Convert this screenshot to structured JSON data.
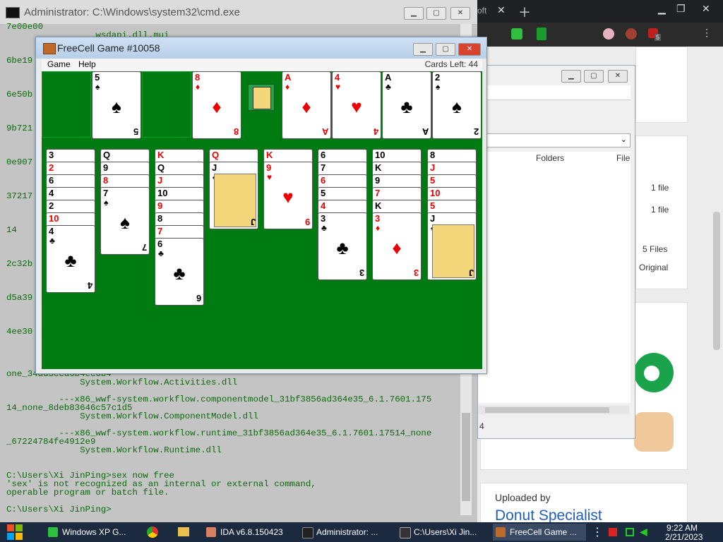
{
  "cmd": {
    "title": "Administrator: C:\\Windows\\system32\\cmd.exe",
    "lines": [
      "7e00e00",
      "                 wsdapi.dll.mui",
      "6be19",
      "6e50b",
      "9b721",
      "0e907",
      "37217",
      "14",
      "2c32b",
      "d5a39",
      "4ee30",
      "one_34dd3cca6b4ec6b4",
      "              System.Workflow.Activities.dll",
      "          ---x86_wwf-system.workflow.componentmodel_31bf3856ad364e35_6.1.7601.175",
      "14_none_8deb83646c57c1d5",
      "              System.Workflow.ComponentModel.dll",
      "          ---x86_wwf-system.workflow.runtime_31bf3856ad364e35_6.1.7601.17514_none",
      "_67224784fe4912e9",
      "              System.Workflow.Runtime.dll",
      "C:\\Users\\Xi JinPing>sex now free",
      "'sex' is not recognized as an internal or external command,",
      "operable program or batch file.",
      "C:\\Users\\Xi JinPing>"
    ]
  },
  "freecell": {
    "title": "FreeCell Game #10058",
    "menu": [
      "Game",
      "Help"
    ],
    "cards_left": "Cards Left: 44",
    "free_cells": [
      {
        "rank": "",
        "suit": ""
      },
      {
        "rank": "5",
        "suit": "♠",
        "color": "black"
      },
      {
        "rank": "",
        "suit": ""
      },
      {
        "rank": "8",
        "suit": "♦",
        "color": "red"
      }
    ],
    "home_cells": [
      {
        "rank": "A",
        "suit": "♦",
        "color": "red"
      },
      {
        "rank": "4",
        "suit": "♥",
        "color": "red"
      },
      {
        "rank": "A",
        "suit": "♣",
        "color": "black"
      },
      {
        "rank": "2",
        "suit": "♠",
        "color": "black"
      }
    ],
    "columns": [
      [
        {
          "r": "3",
          "s": "♠",
          "c": "black"
        },
        {
          "r": "2",
          "s": "♥",
          "c": "red"
        },
        {
          "r": "6",
          "s": "♠",
          "c": "black"
        },
        {
          "r": "4",
          "s": "♠",
          "c": "black"
        },
        {
          "r": "2",
          "s": "♠",
          "c": "black"
        },
        {
          "r": "10",
          "s": "♥",
          "c": "red"
        },
        {
          "r": "4",
          "s": "♣",
          "c": "black"
        }
      ],
      [
        {
          "r": "Q",
          "s": "♠",
          "c": "black"
        },
        {
          "r": "9",
          "s": "♠",
          "c": "black"
        },
        {
          "r": "8",
          "s": "♥",
          "c": "red"
        },
        {
          "r": "7",
          "s": "♠",
          "c": "black"
        }
      ],
      [
        {
          "r": "K",
          "s": "♥",
          "c": "red"
        },
        {
          "r": "Q",
          "s": "♠",
          "c": "black"
        },
        {
          "r": "J",
          "s": "♥",
          "c": "red"
        },
        {
          "r": "10",
          "s": "♠",
          "c": "black"
        },
        {
          "r": "9",
          "s": "♥",
          "c": "red"
        },
        {
          "r": "8",
          "s": "♠",
          "c": "black"
        },
        {
          "r": "7",
          "s": "♥",
          "c": "red"
        },
        {
          "r": "6",
          "s": "♣",
          "c": "black"
        }
      ],
      [
        {
          "r": "Q",
          "s": "♥",
          "c": "red"
        },
        {
          "r": "J",
          "s": "♣",
          "c": "black"
        }
      ],
      [
        {
          "r": "K",
          "s": "♥",
          "c": "red"
        },
        {
          "r": "9",
          "s": "♥",
          "c": "red"
        }
      ],
      [
        {
          "r": "6",
          "s": "♠",
          "c": "black"
        },
        {
          "r": "7",
          "s": "♠",
          "c": "black"
        },
        {
          "r": "6",
          "s": "♥",
          "c": "red"
        },
        {
          "r": "5",
          "s": "♠",
          "c": "black"
        },
        {
          "r": "4",
          "s": "♥",
          "c": "red"
        },
        {
          "r": "3",
          "s": "♣",
          "c": "black"
        }
      ],
      [
        {
          "r": "10",
          "s": "♠",
          "c": "black"
        },
        {
          "r": "K",
          "s": "♠",
          "c": "black"
        },
        {
          "r": "9",
          "s": "♠",
          "c": "black"
        },
        {
          "r": "7",
          "s": "♥",
          "c": "red"
        },
        {
          "r": "K",
          "s": "♠",
          "c": "black"
        },
        {
          "r": "3",
          "s": "♦",
          "c": "red"
        }
      ],
      [
        {
          "r": "8",
          "s": "♠",
          "c": "black"
        },
        {
          "r": "J",
          "s": "♥",
          "c": "red"
        },
        {
          "r": "5",
          "s": "♥",
          "c": "red"
        },
        {
          "r": "10",
          "s": "♥",
          "c": "red"
        },
        {
          "r": "5",
          "s": "♥",
          "c": "red"
        },
        {
          "r": "J",
          "s": "♠",
          "c": "black"
        }
      ]
    ]
  },
  "explorer": {
    "col_folders": "Folders",
    "col_file": "File",
    "rows": [
      "1 file",
      "1 file",
      "5 Files",
      "Original"
    ],
    "status": "4"
  },
  "browser": {
    "tab_suffix": "oft",
    "badge": "5",
    "uploaded_by": "Uploaded by",
    "uploader": "Donut Specialist"
  },
  "taskbar": {
    "items": [
      "Windows XP G...",
      "IDA v6.8.150423",
      "Administrator: ...",
      "C:\\Users\\Xi Jin...",
      "FreeCell Game ..."
    ],
    "time": "9:22 AM",
    "date": "2/21/2023"
  },
  "colors": {
    "felt": "#007b12",
    "taskbar": "#1c2a40",
    "console_text": "#0a6a0a"
  }
}
